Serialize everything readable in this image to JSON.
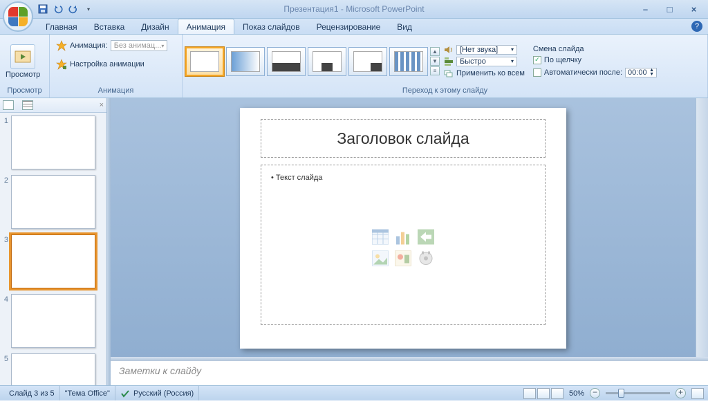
{
  "app": {
    "title": "Презентация1 - Microsoft PowerPoint"
  },
  "tabs": {
    "home": "Главная",
    "insert": "Вставка",
    "design": "Дизайн",
    "animation": "Анимация",
    "slideshow": "Показ слайдов",
    "review": "Рецензирование",
    "view": "Вид"
  },
  "ribbon": {
    "preview_group": {
      "btn": "Просмотр",
      "label": "Просмотр"
    },
    "anim_group": {
      "anim_label": "Анимация:",
      "anim_value": "Без анимац...",
      "custom": "Настройка анимации",
      "label": "Анимация"
    },
    "trans_group": {
      "sound_value": "[Нет звука]",
      "speed_value": "Быстро",
      "apply_all": "Применить ко всем",
      "advance_title": "Смена слайда",
      "on_click": "По щелчку",
      "auto_after": "Автоматически после:",
      "auto_value": "00:00",
      "label": "Переход к этому слайду"
    }
  },
  "slide": {
    "title_ph": "Заголовок слайда",
    "body_ph": "Текст слайда"
  },
  "notes": {
    "placeholder": "Заметки к слайду"
  },
  "thumbs": {
    "count": 5,
    "selected": 3
  },
  "status": {
    "slide_of": "Слайд 3 из 5",
    "theme": "\"Тема Office\"",
    "lang": "Русский (Россия)",
    "zoom": "50%"
  }
}
